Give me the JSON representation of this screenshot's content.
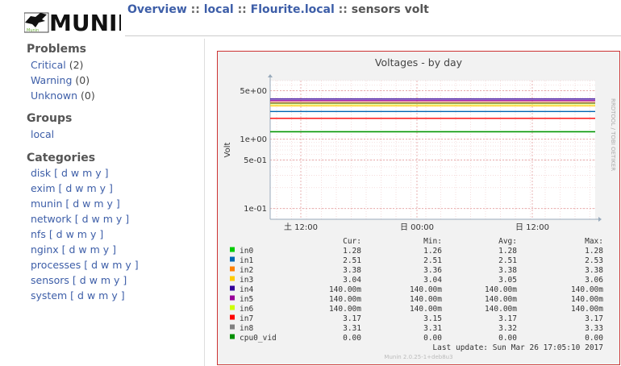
{
  "header": {
    "logo_text": "MUNIN",
    "breadcrumb": {
      "items": [
        "Overview",
        "local",
        "Flourite.local"
      ],
      "separator": "::",
      "current": "sensors volt"
    }
  },
  "sidebar": {
    "problems": {
      "title": "Problems",
      "items": [
        {
          "label": "Critical",
          "count": "(2)"
        },
        {
          "label": "Warning",
          "count": "(0)"
        },
        {
          "label": "Unknown",
          "count": "(0)"
        }
      ]
    },
    "groups": {
      "title": "Groups",
      "items": [
        "local"
      ]
    },
    "categories": {
      "title": "Categories",
      "periods": [
        "d",
        "w",
        "m",
        "y"
      ],
      "items": [
        "disk",
        "exim",
        "munin",
        "network",
        "nfs",
        "nginx",
        "processes",
        "sensors",
        "system"
      ]
    }
  },
  "graph": {
    "watermark": "RRDTOOL / TOBI OETIKER",
    "footer": "Munin 2.0.25-1+deb8u3",
    "last_update": "Last update:  Sun Mar 26 17:05:10 2017",
    "table_headers": [
      "Cur:",
      "Min:",
      "Avg:",
      "Max:"
    ],
    "rows": [
      {
        "name": "in0",
        "color": "#00cc00",
        "cur": "1.28",
        "min": "1.26",
        "avg": "1.28",
        "max": "1.28"
      },
      {
        "name": "in1",
        "color": "#0066b3",
        "cur": "2.51",
        "min": "2.51",
        "avg": "2.51",
        "max": "2.53"
      },
      {
        "name": "in2",
        "color": "#ff8000",
        "cur": "3.38",
        "min": "3.36",
        "avg": "3.38",
        "max": "3.38"
      },
      {
        "name": "in3",
        "color": "#ffcc00",
        "cur": "3.04",
        "min": "3.04",
        "avg": "3.05",
        "max": "3.06"
      },
      {
        "name": "in4",
        "color": "#330099",
        "cur": "140.00m",
        "min": "140.00m",
        "avg": "140.00m",
        "max": "140.00m"
      },
      {
        "name": "in5",
        "color": "#990099",
        "cur": "140.00m",
        "min": "140.00m",
        "avg": "140.00m",
        "max": "140.00m"
      },
      {
        "name": "in6",
        "color": "#ccff00",
        "cur": "140.00m",
        "min": "140.00m",
        "avg": "140.00m",
        "max": "140.00m"
      },
      {
        "name": "in7",
        "color": "#ff0000",
        "cur": "3.17",
        "min": "3.15",
        "avg": "3.17",
        "max": "3.17"
      },
      {
        "name": "in8",
        "color": "#808080",
        "cur": "3.31",
        "min": "3.31",
        "avg": "3.32",
        "max": "3.33"
      },
      {
        "name": "cpu0_vid",
        "color": "#008f00",
        "cur": "0.00",
        "min": "0.00",
        "avg": "0.00",
        "max": "0.00"
      }
    ]
  },
  "chart_data": {
    "type": "line",
    "title": "Voltages - by day",
    "xlabel": "",
    "ylabel": "Volt",
    "y_scale": "log",
    "ylim": [
      0.07,
      7
    ],
    "y_ticks": [
      "5e+00",
      "1e+00",
      "5e-01",
      "1e-01"
    ],
    "y_tick_values": [
      5,
      1,
      0.5,
      0.1
    ],
    "x_ticks": [
      "土 12:00",
      "日 00:00",
      "日 12:00"
    ],
    "grid": true,
    "legend": "below",
    "series": [
      {
        "name": "in0",
        "color": "#00cc00",
        "values": [
          1.28,
          1.28
        ]
      },
      {
        "name": "in1",
        "color": "#0066b3",
        "values": [
          2.51,
          2.51
        ]
      },
      {
        "name": "in2",
        "color": "#ff8000",
        "values": [
          3.38,
          3.38
        ]
      },
      {
        "name": "in3",
        "color": "#ffcc00",
        "values": [
          3.04,
          3.04
        ]
      },
      {
        "name": "in4",
        "color": "#330099",
        "values": [
          3.8,
          3.8
        ]
      },
      {
        "name": "in5",
        "color": "#990099",
        "values": [
          3.6,
          3.6
        ]
      },
      {
        "name": "in6",
        "color": "#ccff00",
        "values": [
          3.25,
          3.25
        ]
      },
      {
        "name": "in7",
        "color": "#ff0000",
        "values": [
          2.0,
          2.0
        ]
      },
      {
        "name": "in8",
        "color": "#808080",
        "values": [
          3.31,
          3.31
        ]
      },
      {
        "name": "cpu0_vid",
        "color": "#008f00",
        "values": [
          1.28,
          1.28
        ]
      }
    ]
  }
}
